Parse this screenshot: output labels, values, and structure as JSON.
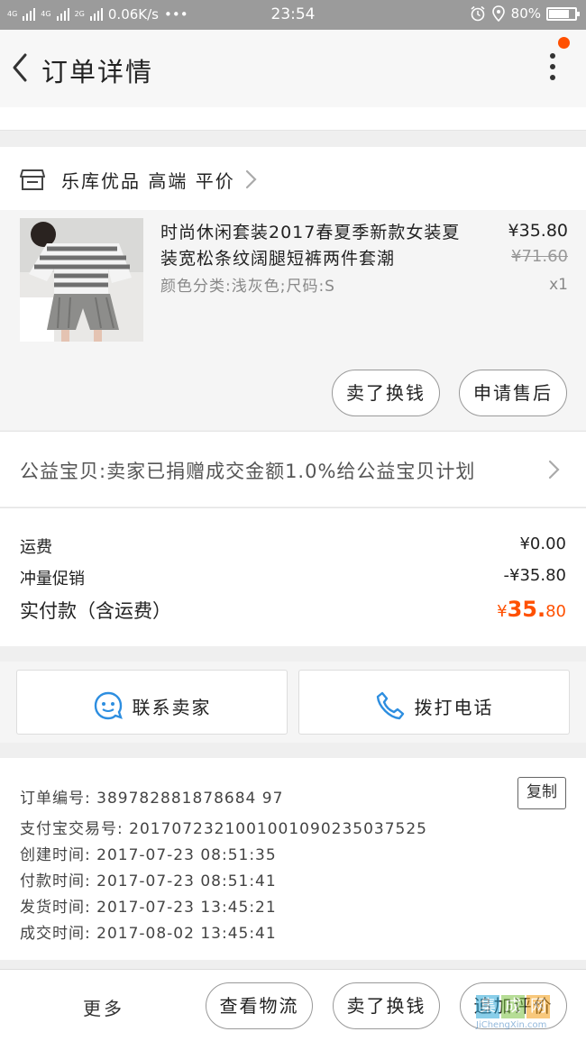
{
  "status_bar": {
    "network_1": "4G",
    "network_2": "4G",
    "network_3": "2G",
    "speed": "0.06K/s",
    "dots": "•••",
    "time": "23:54",
    "battery": "80%",
    "battery_level": 0.8
  },
  "header": {
    "title": "订单详情"
  },
  "store": {
    "name": "乐库优品 高端 平价"
  },
  "item": {
    "title": "时尚休闲套装2017春夏季新款女装夏装宽松条纹阔腿短裤两件套潮",
    "spec": "颜色分类:浅灰色;尺码:S",
    "price": "¥35.80",
    "original_price": "¥71.60",
    "quantity": "x1",
    "resell_label": "卖了换钱",
    "after_sale_label": "申请售后"
  },
  "charity": {
    "text": "公益宝贝:卖家已捐赠成交金额1.0%给公益宝贝计划"
  },
  "costs": {
    "shipping_label": "运费",
    "shipping_value": "¥0.00",
    "promo_label": "冲量促销",
    "promo_value": "-¥35.80",
    "total_label": "实付款（含运费）",
    "total_currency": "¥",
    "total_int": "35.",
    "total_dec": "80"
  },
  "contacts": {
    "seller_label": "联系卖家",
    "call_label": "拨打电话"
  },
  "order_info": {
    "order_no": "订单编号: 389782881878684 97",
    "copy_label": "复制",
    "alipay_no": "支付宝交易号: 2017072321001001090235037525",
    "created": "创建时间: 2017-07-23 08:51:35",
    "paid": "付款时间: 2017-07-23 08:51:41",
    "shipped": "发货时间: 2017-07-23 13:45:21",
    "completed": "成交时间: 2017-08-02 13:45:41"
  },
  "bottom_bar": {
    "more_label": "更多",
    "logistics_label": "查看物流",
    "resell_label": "卖了换钱",
    "review_label": "追加评价"
  },
  "watermark": {
    "chars": [
      "集",
      "成",
      "网"
    ],
    "url": "JiChengXin.com"
  },
  "colors": {
    "accent": "#ff5000",
    "status_bar": "#9b9b9b",
    "page_bg": "#efefef",
    "chat_icon": "#2d8ee0"
  },
  "icons": [
    "back-arrow-icon",
    "more-vertical-icon",
    "store-icon",
    "chevron-right-icon",
    "chat-bubble-icon",
    "phone-icon"
  ]
}
